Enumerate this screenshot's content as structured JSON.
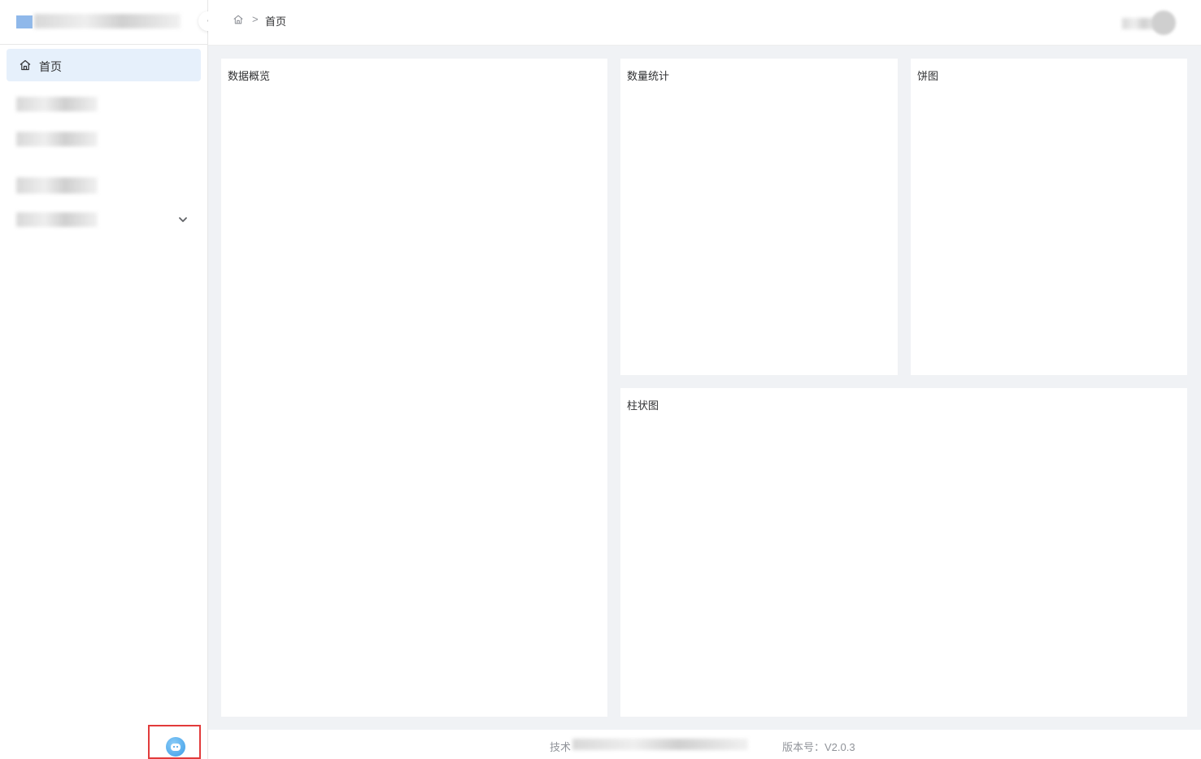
{
  "sidebar": {
    "menu": [
      {
        "label": "首页",
        "icon": "home-icon",
        "active": true
      },
      {
        "label": "",
        "icon": "redacted"
      },
      {
        "label": "",
        "icon": "redacted"
      },
      {
        "label": "",
        "icon": "redacted"
      },
      {
        "label": "",
        "icon": "chevron-down-icon",
        "expandable": true
      }
    ]
  },
  "header": {
    "breadcrumb": {
      "separator": ">",
      "current": "首页"
    }
  },
  "main": {
    "cards": [
      {
        "title": "数据概览"
      },
      {
        "title": "数量统计"
      },
      {
        "title": "饼图"
      },
      {
        "title": "柱状图"
      }
    ]
  },
  "footer": {
    "support_prefix": "技术",
    "version_label": "版本号：",
    "version": "V2.0.3"
  },
  "colors": {
    "accent_bg": "#e6f0fb",
    "content_bg": "#f0f2f5",
    "highlight_border": "#e23b3b"
  }
}
